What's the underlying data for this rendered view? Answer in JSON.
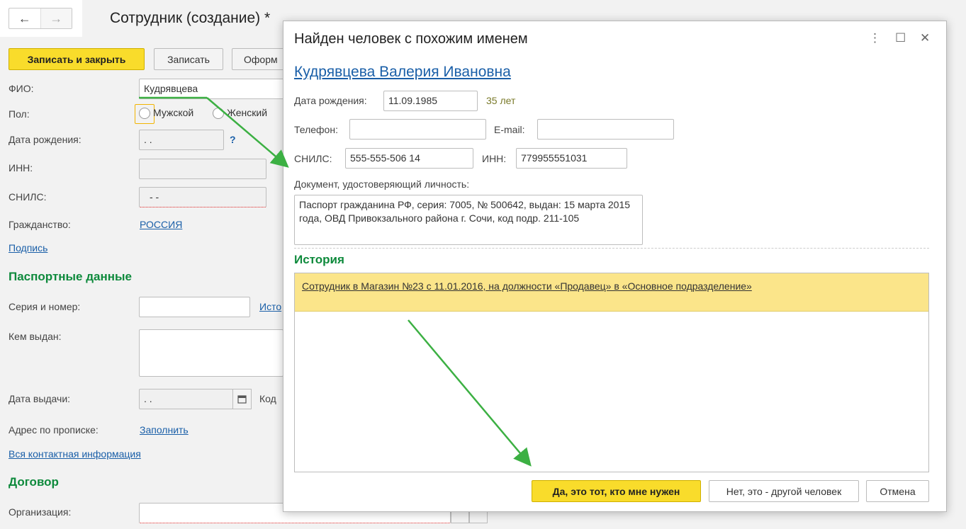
{
  "form": {
    "title": "Сотрудник (создание) *",
    "nav_back": "←",
    "nav_forward": "→",
    "btn_save_close": "Записать и закрыть",
    "btn_save": "Записать",
    "btn_format": "Оформ",
    "fio_label": "ФИО:",
    "fio_value": "Кудрявцева",
    "gender_label": "Пол:",
    "gender_male": "Мужской",
    "gender_female": "Женский",
    "birth_label": "Дата рождения:",
    "birth_value": " .  .",
    "birth_help": "?",
    "inn_label": "ИНН:",
    "snils_label": "СНИЛС:",
    "snils_value": "-  -",
    "citizenship_label": "Гражданство:",
    "citizenship_value": "РОССИЯ",
    "signature_link": "Подпись",
    "passport_section": "Паспортные данные",
    "series_label": "Серия и номер:",
    "history_link_cut": "Исто",
    "issued_by_label": "Кем выдан:",
    "issue_date_label": "Дата выдачи:",
    "issue_date_value": " .  .",
    "code_label_cut": "Код",
    "address_label": "Адрес по прописке:",
    "address_fill_link": "Заполнить",
    "contacts_link": "Вся контактная информация",
    "contract_section": "Договор",
    "org_label": "Организация:"
  },
  "dialog": {
    "title": "Найден человек с похожим именем",
    "person_name": "Кудрявцева Валерия Ивановна",
    "birth_label": "Дата рождения:",
    "birth_value": "11.09.1985",
    "age": "35 лет",
    "phone_label": "Телефон:",
    "phone_value": "",
    "email_label": "E-mail:",
    "email_value": "",
    "snils_label": "СНИЛС:",
    "snils_value": "555-555-506 14",
    "inn_label": "ИНН:",
    "inn_value": "779955551031",
    "doc_label": "Документ, удостоверяющий личность:",
    "doc_value": "Паспорт гражданина РФ, серия: 7005, № 500642, выдан: 15 марта 2015 года, ОВД Привокзального района г. Сочи, код подр. 211-105",
    "history_title": "История",
    "history_items": [
      "Сотрудник в Магазин №23 с 11.01.2016, на должности «Продавец» в «Основное подразделение»"
    ],
    "btn_yes": "Да, это тот, кто мне нужен",
    "btn_no": "Нет, это - другой человек",
    "btn_cancel": "Отмена"
  },
  "colors": {
    "accent_yellow": "#f9dc2b",
    "section_green": "#0e8a3c",
    "link_blue": "#1a5fa8",
    "arrow_green": "#3cb043",
    "history_highlight": "#fbe58a"
  }
}
